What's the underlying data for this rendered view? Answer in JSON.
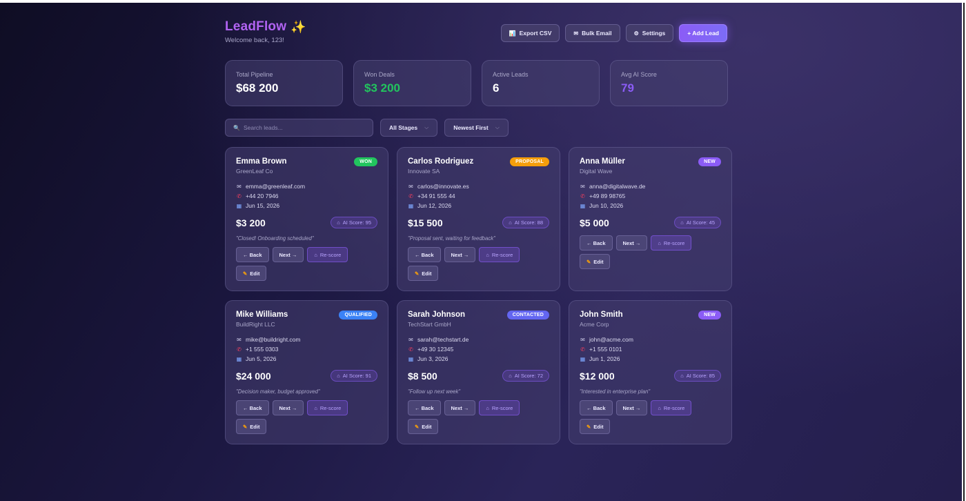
{
  "app": {
    "title": "LeadFlow",
    "title_icon": "sparkles-icon",
    "welcome": "Welcome back, 123!"
  },
  "toolbar": {
    "export_label": "Export CSV",
    "export_icon": "📊",
    "bulk_email_label": "Bulk Email",
    "bulk_email_icon": "✉",
    "settings_label": "Settings",
    "settings_icon": "⚙",
    "add_lead_label": "+ Add Lead"
  },
  "stats": [
    {
      "label": "Total Pipeline",
      "value": "$68 200",
      "color": "#ffffff"
    },
    {
      "label": "Won Deals",
      "value": "$3 200",
      "color": "#22c55e"
    },
    {
      "label": "Active Leads",
      "value": "6",
      "color": "#ffffff"
    },
    {
      "label": "Avg AI Score",
      "value": "79",
      "color": "#8b5cf6"
    }
  ],
  "filters": {
    "search_placeholder": "Search leads...",
    "stage_value": "All Stages",
    "sort_value": "Newest First"
  },
  "card_buttons": {
    "back": "← Back",
    "next": "Next →",
    "rescore": "Re-score",
    "edit": "Edit"
  },
  "leads": [
    {
      "name": "Emma Brown",
      "company": "GreenLeaf Co",
      "stage": "WON",
      "stage_color": "#22c55e",
      "email": "emma@greenleaf.com",
      "phone": "+44 20 7946",
      "date": "Jun 15, 2026",
      "amount": "$3 200",
      "score": "AI Score: 95",
      "note": "\"Closed! Onboarding scheduled\""
    },
    {
      "name": "Carlos Rodriguez",
      "company": "Innovate SA",
      "stage": "PROPOSAL",
      "stage_color": "#f59e0b",
      "email": "carlos@innovate.es",
      "phone": "+34 91 555 44",
      "date": "Jun 12, 2026",
      "amount": "$15 500",
      "score": "AI Score: 88",
      "note": "\"Proposal sent, waiting for feedback\""
    },
    {
      "name": "Anna Müller",
      "company": "Digital Wave",
      "stage": "NEW",
      "stage_color": "#8b5cf6",
      "email": "anna@digitalwave.de",
      "phone": "+49 89 98765",
      "date": "Jun 10, 2026",
      "amount": "$5 000",
      "score": "AI Score: 45",
      "note": ""
    },
    {
      "name": "Mike Williams",
      "company": "BuildRight LLC",
      "stage": "QUALIFIED",
      "stage_color": "#3b82f6",
      "email": "mike@buildright.com",
      "phone": "+1 555 0303",
      "date": "Jun 5, 2026",
      "amount": "$24 000",
      "score": "AI Score: 91",
      "note": "\"Decision maker, budget approved\""
    },
    {
      "name": "Sarah Johnson",
      "company": "TechStart GmbH",
      "stage": "CONTACTED",
      "stage_color": "#6366f1",
      "email": "sarah@techstart.de",
      "phone": "+49 30 12345",
      "date": "Jun 3, 2026",
      "amount": "$8 500",
      "score": "AI Score: 72",
      "note": "\"Follow up next week\""
    },
    {
      "name": "John Smith",
      "company": "Acme Corp",
      "stage": "NEW",
      "stage_color": "#8b5cf6",
      "email": "john@acme.com",
      "phone": "+1 555 0101",
      "date": "Jun 1, 2026",
      "amount": "$12 000",
      "score": "AI Score: 85",
      "note": "\"Interested in enterprise plan\""
    }
  ]
}
